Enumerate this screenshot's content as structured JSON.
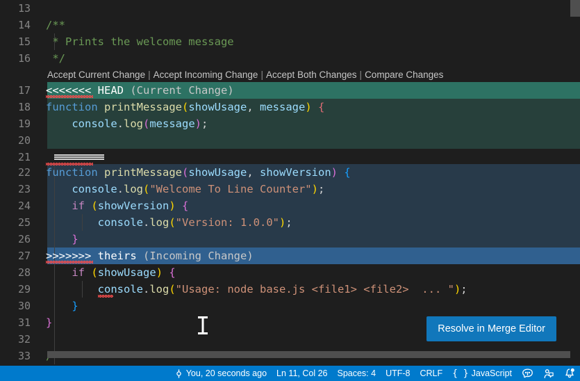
{
  "editor": {
    "first_visible_line": 13,
    "lines": [
      {
        "num": 13,
        "text": ""
      },
      {
        "num": 14,
        "text": "/**"
      },
      {
        "num": 15,
        "text": " * Prints the welcome message"
      },
      {
        "num": 16,
        "text": " */"
      },
      {
        "num": 17,
        "text": "<<<<<<< HEAD (Current Change)"
      },
      {
        "num": 18,
        "text": "function printMessage(showUsage, message) {"
      },
      {
        "num": 19,
        "text": "    console.log(message);"
      },
      {
        "num": 20,
        "text": ""
      },
      {
        "num": 21,
        "text": "======="
      },
      {
        "num": 22,
        "text": "function printMessage(showUsage, showVersion) {"
      },
      {
        "num": 23,
        "text": "    console.log(\"Welcome To Line Counter\");"
      },
      {
        "num": 24,
        "text": "    if (showVersion) {"
      },
      {
        "num": 25,
        "text": "        console.log(\"Version: 1.0.0\");"
      },
      {
        "num": 26,
        "text": "    }"
      },
      {
        "num": 27,
        "text": ">>>>>>> theirs (Incoming Change)"
      },
      {
        "num": 28,
        "text": "    if (showUsage) {"
      },
      {
        "num": 29,
        "text": "        console.log(\"Usage: node base.js <file1> <file2>  ... \");"
      },
      {
        "num": 30,
        "text": "    }"
      },
      {
        "num": 31,
        "text": "}"
      },
      {
        "num": 32,
        "text": ""
      },
      {
        "num": 33,
        "text": "/**"
      }
    ],
    "conflict": {
      "current_marker": "<<<<<<<",
      "current_ref": "HEAD",
      "current_label": "(Current Change)",
      "separator_marker": "=======",
      "incoming_marker": ">>>>>>>",
      "incoming_ref": "theirs",
      "incoming_label": "(Incoming Change)"
    },
    "codelens": {
      "accept_current": "Accept Current Change",
      "accept_incoming": "Accept Incoming Change",
      "accept_both": "Accept Both Changes",
      "compare": "Compare Changes",
      "separator": "|"
    },
    "resolve_button": "Resolve in Merge Editor",
    "colors": {
      "editor_background": "#1e1e1e",
      "current_header": "#2d7263",
      "current_body": "#27403b",
      "incoming_header": "#30608f",
      "incoming_body": "#283a4a",
      "line_number": "#858585",
      "button": "#1177bb",
      "status_bar": "#007acc",
      "squiggle": "#f14c4c"
    }
  },
  "statusbar": {
    "git_blame": "You, 20 seconds ago",
    "git_blame_icon": "git-commit-icon",
    "cursor_position": "Ln 11, Col 26",
    "indentation": "Spaces: 4",
    "encoding": "UTF-8",
    "eol": "CRLF",
    "language": "JavaScript",
    "language_icon": "braces-icon",
    "live_share_icon": "live-share-icon",
    "remote_icon": "remote-explorer-icon",
    "notifications_icon": "bell-dot-icon"
  }
}
